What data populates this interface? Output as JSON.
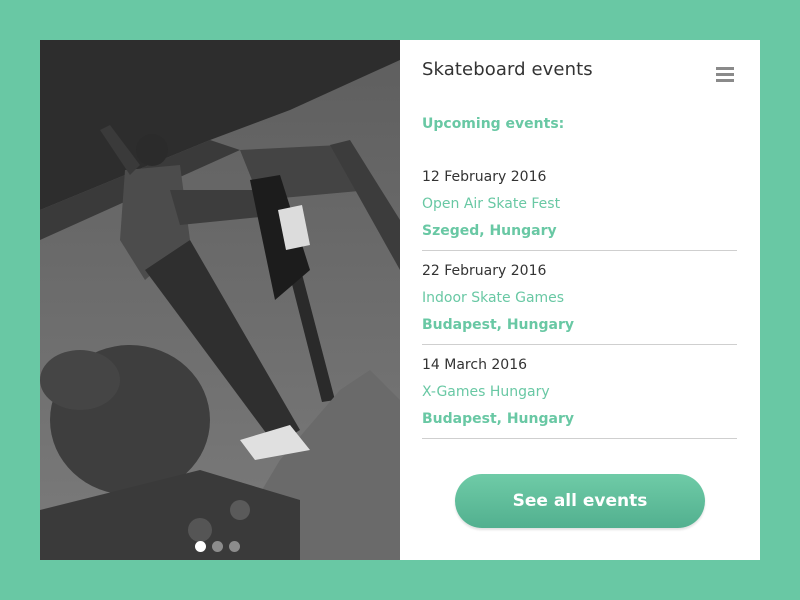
{
  "panel": {
    "title": "Skateboard events",
    "section_label": "Upcoming events:",
    "events": [
      {
        "date": "12 February 2016",
        "name": "Open Air Skate Fest",
        "location": "Szeged, Hungary"
      },
      {
        "date": "22 February 2016",
        "name": "Indoor Skate Games",
        "location": "Budapest, Hungary"
      },
      {
        "date": "14 March 2016",
        "name": "X-Games Hungary",
        "location": "Budapest, Hungary"
      }
    ],
    "cta_label": "See all events"
  },
  "carousel": {
    "slides": 3,
    "active_index": 0
  },
  "icons": {
    "menu": "hamburger-menu-icon"
  },
  "colors": {
    "accent": "#69c8a4",
    "background": "#69c8a4",
    "card": "#ffffff",
    "text": "#333333"
  }
}
